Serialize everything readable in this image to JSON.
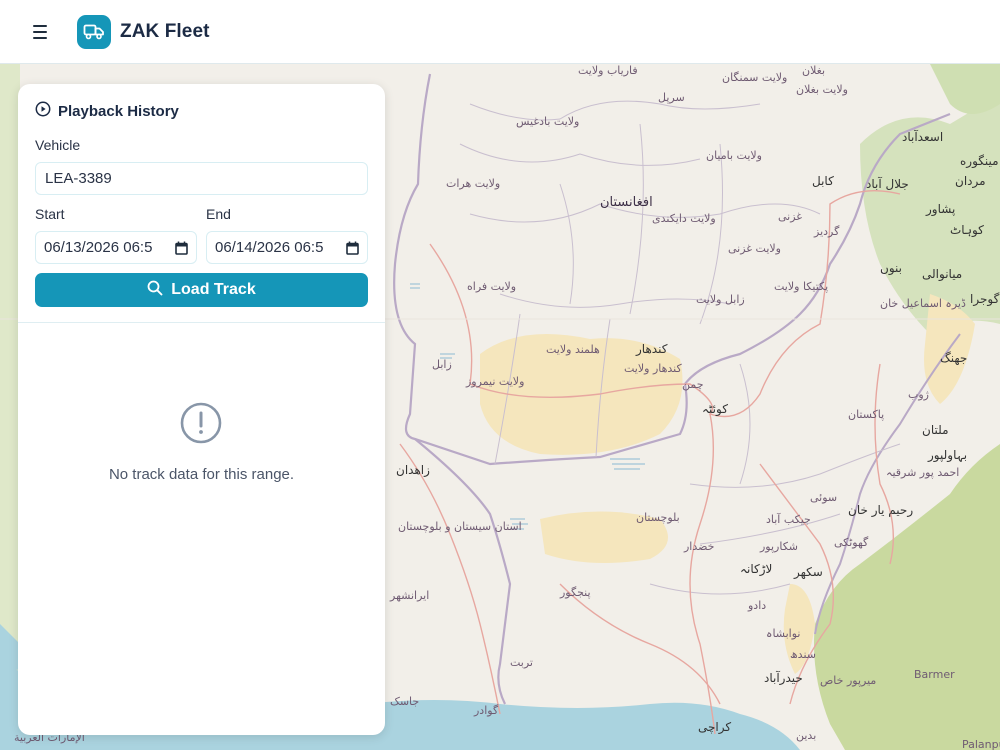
{
  "header": {
    "menu_icon": "hamburger-icon",
    "logo_icon": "truck-icon",
    "brand": "ZAK Fleet",
    "accent_color": "#1596b8"
  },
  "panel": {
    "title_icon": "play-circle-icon",
    "title": "Playback History",
    "vehicle_label": "Vehicle",
    "vehicle_value": "LEA-3389",
    "start_label": "Start",
    "start_value": "06/13/2026 06:5",
    "end_label": "End",
    "end_value": "06/14/2026 06:5",
    "load_button_icon": "search-icon",
    "load_button_label": "Load Track",
    "empty_icon": "alert-circle-icon",
    "empty_message": "No track data for this range."
  },
  "map": {
    "labels": [
      "فاریاب ولایت",
      "بغلان",
      "ولایت سمنگان",
      "ولایت بغلان",
      "سرپل",
      "ولایت بادغیس",
      "اسعدآباد",
      "ولایت بامیان",
      "کابل",
      "جلال آباد",
      "مینگوره",
      "مردان",
      "ولایت هرات",
      "افغانستان",
      "غزنی",
      "ولایت دایکندی",
      "گردیز",
      "پشاور",
      "کوہاٹ",
      "ولایت غزنی",
      "بنوں",
      "میانوالی",
      "ولایت فراه",
      "پکتیکا ولایت",
      "زابل ولایت",
      "ڈیرہ اسماعیل خان",
      "گوجرا",
      "زابل",
      "هلمند ولایت",
      "کندهار",
      "ولایت نیمروز",
      "کندهار ولایت",
      "چمن",
      "بلوچستان",
      "کوئٹہ",
      "پاکستان",
      "جھنگ",
      "ژوب",
      "ملتان",
      "زاهدان",
      "بہاولپور",
      "احمد پور شرقیہ",
      "سوئی",
      "رحیم یار خان",
      "استان سیستان و بلوچستان",
      "بلوچستان",
      "جیکب آباد",
      "گھوٹکی",
      "شکارپور",
      "خضدار",
      "لاڑکانہ",
      "سکھر",
      "ایرانشهر",
      "پنجگور",
      "دادو",
      "نوابشاہ",
      "سندھ",
      "تربت",
      "حیدرآباد",
      "میرپور خاص",
      "Barmer",
      "جاسک",
      "گوادر",
      "کراچی",
      "بدین",
      "الإمارات العربية",
      "Palanpu"
    ]
  }
}
